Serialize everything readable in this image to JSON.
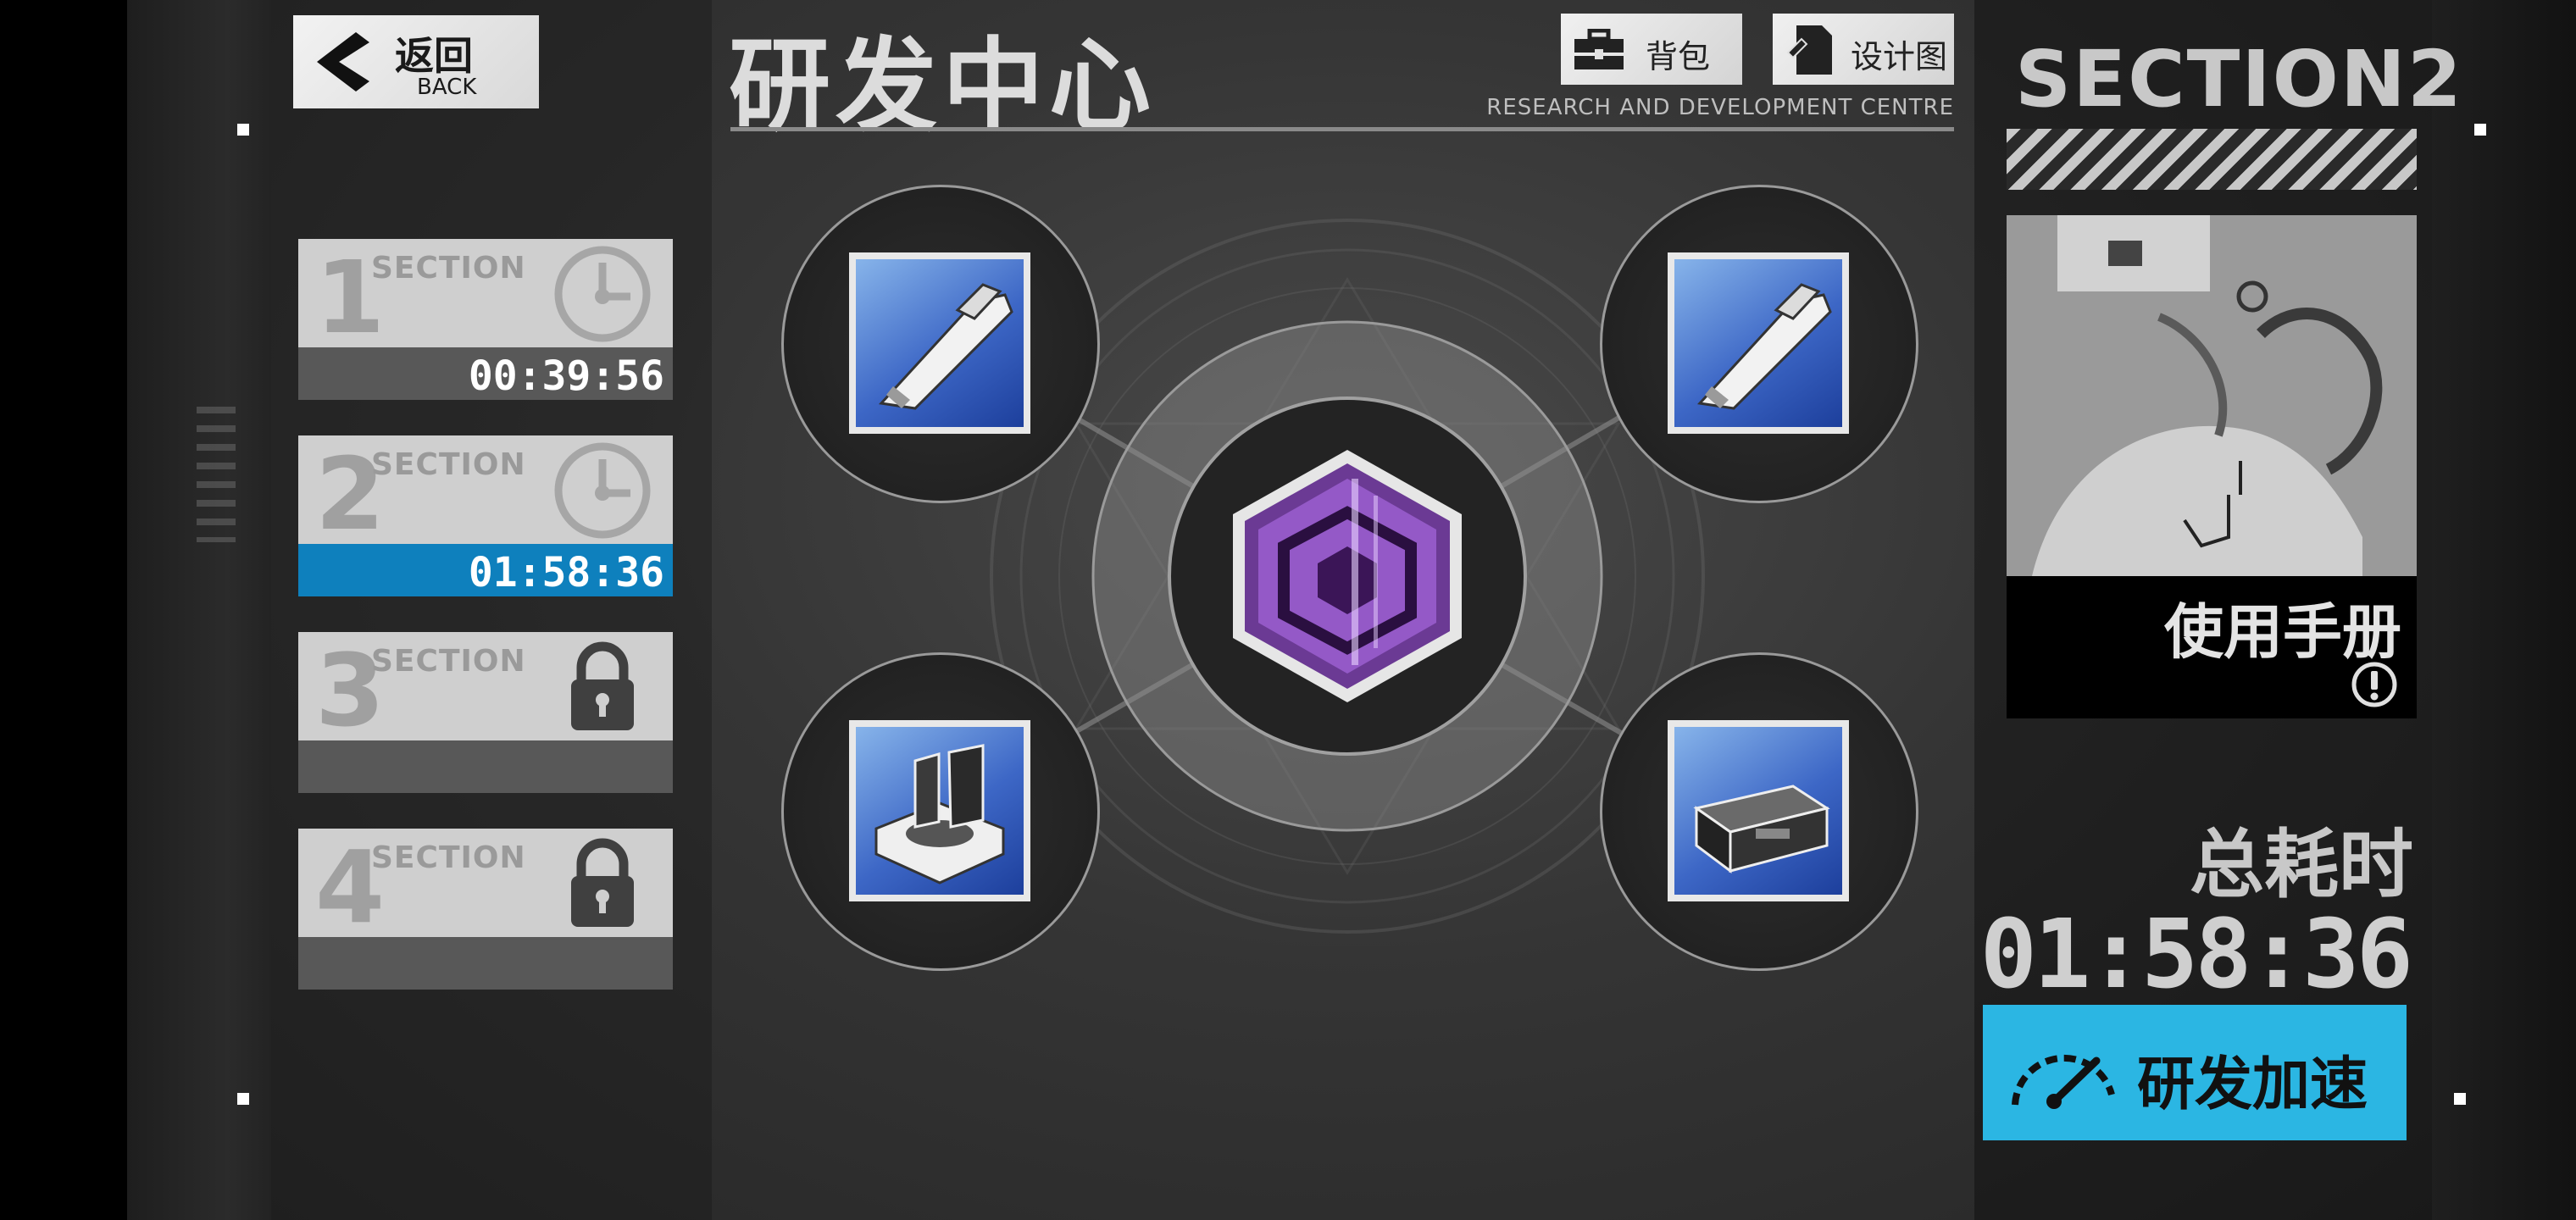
{
  "back": {
    "label": "返回",
    "sub": "BACK"
  },
  "header": {
    "title": "研发中心",
    "subtitle": "RESEARCH AND DEVELOPMENT CENTRE",
    "bag_label": "背包",
    "blueprint_label": "设计图"
  },
  "sections": [
    {
      "number": "1",
      "label": "SECTION",
      "time": "00:39:56",
      "state": "timer"
    },
    {
      "number": "2",
      "label": "SECTION",
      "time": "01:58:36",
      "state": "timer-active"
    },
    {
      "number": "3",
      "label": "SECTION",
      "time": "",
      "state": "locked"
    },
    {
      "number": "4",
      "label": "SECTION",
      "time": "",
      "state": "locked"
    }
  ],
  "panel": {
    "heading": "SECTION2",
    "manual_title": "使用手册",
    "total_label": "总耗时",
    "total_time": "01:58:36",
    "accelerate_label": "研发加速"
  },
  "icons": {
    "back": "back-arrow-icon",
    "bag": "toolbox-icon",
    "blueprint": "blueprint-icon",
    "timer": "clock-icon",
    "locked": "lock-icon",
    "info": "exclamation-circle-icon",
    "speed": "speedometer-icon"
  },
  "colors": {
    "active_section": "#0e80bd",
    "accelerate": "#2bb6e3",
    "core_purple": "#9b5fd0"
  }
}
